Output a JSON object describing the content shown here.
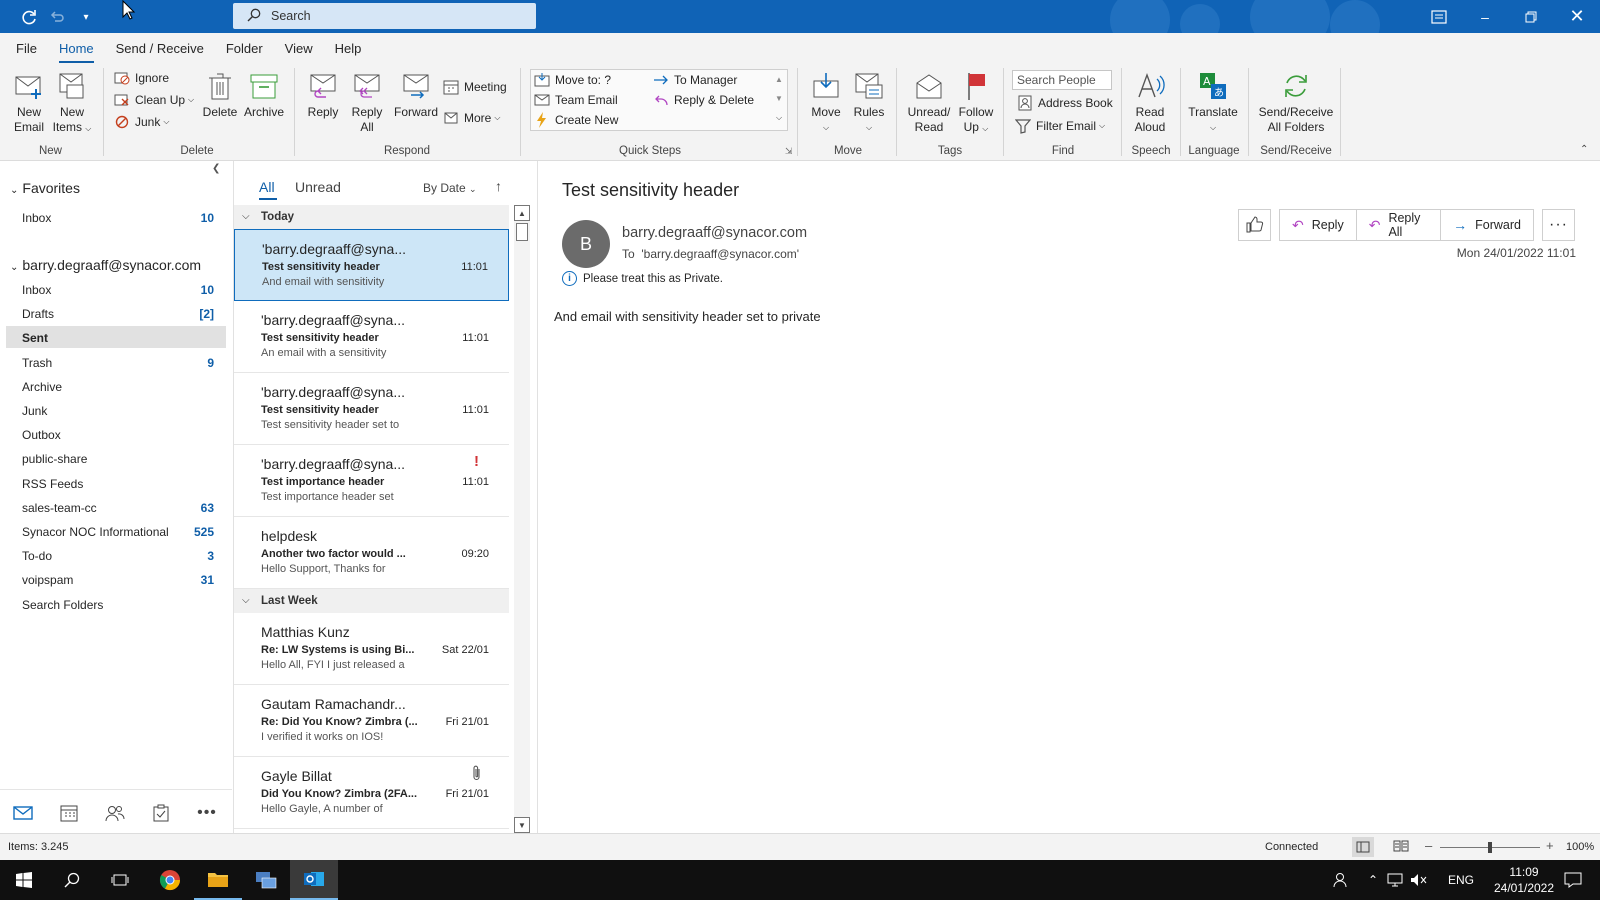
{
  "titlebar": {
    "search_placeholder": "Search",
    "icons": [
      "sync-icon",
      "undo-icon",
      "customize-qat-icon",
      "coming-soon-icon",
      "minimize-icon",
      "restore-icon",
      "close-icon"
    ]
  },
  "menu": {
    "tabs": [
      "File",
      "Home",
      "Send / Receive",
      "Folder",
      "View",
      "Help"
    ],
    "active": "Home"
  },
  "ribbon": {
    "new_email": [
      "New",
      "Email"
    ],
    "new_items": [
      "New",
      "Items"
    ],
    "ignore": "Ignore",
    "clean_up": "Clean Up",
    "junk": "Junk",
    "delete": "Delete",
    "archive": "Archive",
    "reply": "Reply",
    "reply_all": [
      "Reply",
      "All"
    ],
    "forward": "Forward",
    "meeting": "Meeting",
    "more": "More",
    "quick_steps": [
      "Move to: ?",
      "Team Email",
      "Create New",
      "To Manager",
      "Reply & Delete"
    ],
    "move": "Move",
    "rules": "Rules",
    "unread_read": [
      "Unread/",
      "Read"
    ],
    "follow_up": [
      "Follow",
      "Up"
    ],
    "search_people": "Search People",
    "address_book": "Address Book",
    "filter_email": "Filter Email",
    "read_aloud": [
      "Read",
      "Aloud"
    ],
    "translate": "Translate",
    "send_receive_all": [
      "Send/Receive",
      "All Folders"
    ],
    "groups": [
      "New",
      "Delete",
      "Respond",
      "Quick Steps",
      "Move",
      "Tags",
      "Find",
      "Speech",
      "Language",
      "Send/Receive"
    ]
  },
  "nav": {
    "favorites_label": "Favorites",
    "favorites": [
      {
        "label": "Inbox",
        "count": "10"
      }
    ],
    "account": "barry.degraaff@synacor.com",
    "folders": [
      {
        "label": "Inbox",
        "count": "10"
      },
      {
        "label": "Drafts",
        "count": "[2]"
      },
      {
        "label": "Sent",
        "count": ""
      },
      {
        "label": "Trash",
        "count": "9"
      },
      {
        "label": "Archive",
        "count": ""
      },
      {
        "label": "Junk",
        "count": ""
      },
      {
        "label": "Outbox",
        "count": ""
      },
      {
        "label": "public-share",
        "count": ""
      },
      {
        "label": "RSS Feeds",
        "count": ""
      },
      {
        "label": "sales-team-cc",
        "count": "63"
      },
      {
        "label": "Synacor NOC Informational",
        "count": "525"
      },
      {
        "label": "To-do",
        "count": "3"
      },
      {
        "label": "voipspam",
        "count": "31"
      },
      {
        "label": "Search Folders",
        "count": ""
      }
    ],
    "selected": "Sent"
  },
  "list": {
    "filter_all": "All",
    "filter_unread": "Unread",
    "sort": "By Date",
    "groups": [
      {
        "label": "Today",
        "messages": [
          {
            "from": "'barry.degraaff@syna...",
            "subject": "Test sensitivity header",
            "preview": "And email with sensitivity",
            "time": "11:01",
            "selected": true
          },
          {
            "from": "'barry.degraaff@syna...",
            "subject": "Test sensitivity header",
            "preview": "An email with a sensitivity",
            "time": "11:01"
          },
          {
            "from": "'barry.degraaff@syna...",
            "subject": "Test sensitivity header",
            "preview": "Test sensitivity header set to",
            "time": "11:01"
          },
          {
            "from": "'barry.degraaff@syna...",
            "subject": "Test importance header",
            "preview": "Test importance header set",
            "time": "11:01",
            "important": true
          },
          {
            "from": "helpdesk",
            "subject": "Another two factor would ...",
            "preview": "Hello Support,  Thanks for",
            "time": "09:20"
          }
        ]
      },
      {
        "label": "Last Week",
        "messages": [
          {
            "from": "Matthias Kunz",
            "subject": "Re: LW Systems is using Bi...",
            "preview": "Hello All,  FYI I just released a",
            "time": "Sat 22/01"
          },
          {
            "from": "Gautam Ramachandr...",
            "subject": "Re: Did You Know? Zimbra (...",
            "preview": "I verified it works on IOS!",
            "time": "Fri 21/01"
          },
          {
            "from": "Gayle Billat",
            "subject": "Did You Know? Zimbra (2FA...",
            "preview": "Hello Gayle,  A number of",
            "time": "Fri 21/01",
            "attachment": true
          }
        ]
      }
    ]
  },
  "reading": {
    "subject": "Test sensitivity header",
    "avatar_letter": "B",
    "sender": "barry.degraaff@synacor.com",
    "to_label": "To",
    "to_value": "'barry.degraaff@synacor.com'",
    "info": "Please treat this as Private.",
    "date": "Mon 24/01/2022 11:01",
    "body": "And email with sensitivity header set to private",
    "actions": {
      "reply": "Reply",
      "reply_all": "Reply All",
      "forward": "Forward"
    }
  },
  "status": {
    "items": "Items: 3.245",
    "connection": "Connected",
    "zoom": "100%",
    "zoom_level": 0.5
  },
  "taskbar": {
    "lang": "ENG",
    "time": "11:09",
    "date": "24/01/2022"
  },
  "colors": {
    "accent": "#0f6cbd",
    "titlebar": "#1063b6",
    "selected_row": "#cde6f7",
    "important": "#d13438"
  }
}
